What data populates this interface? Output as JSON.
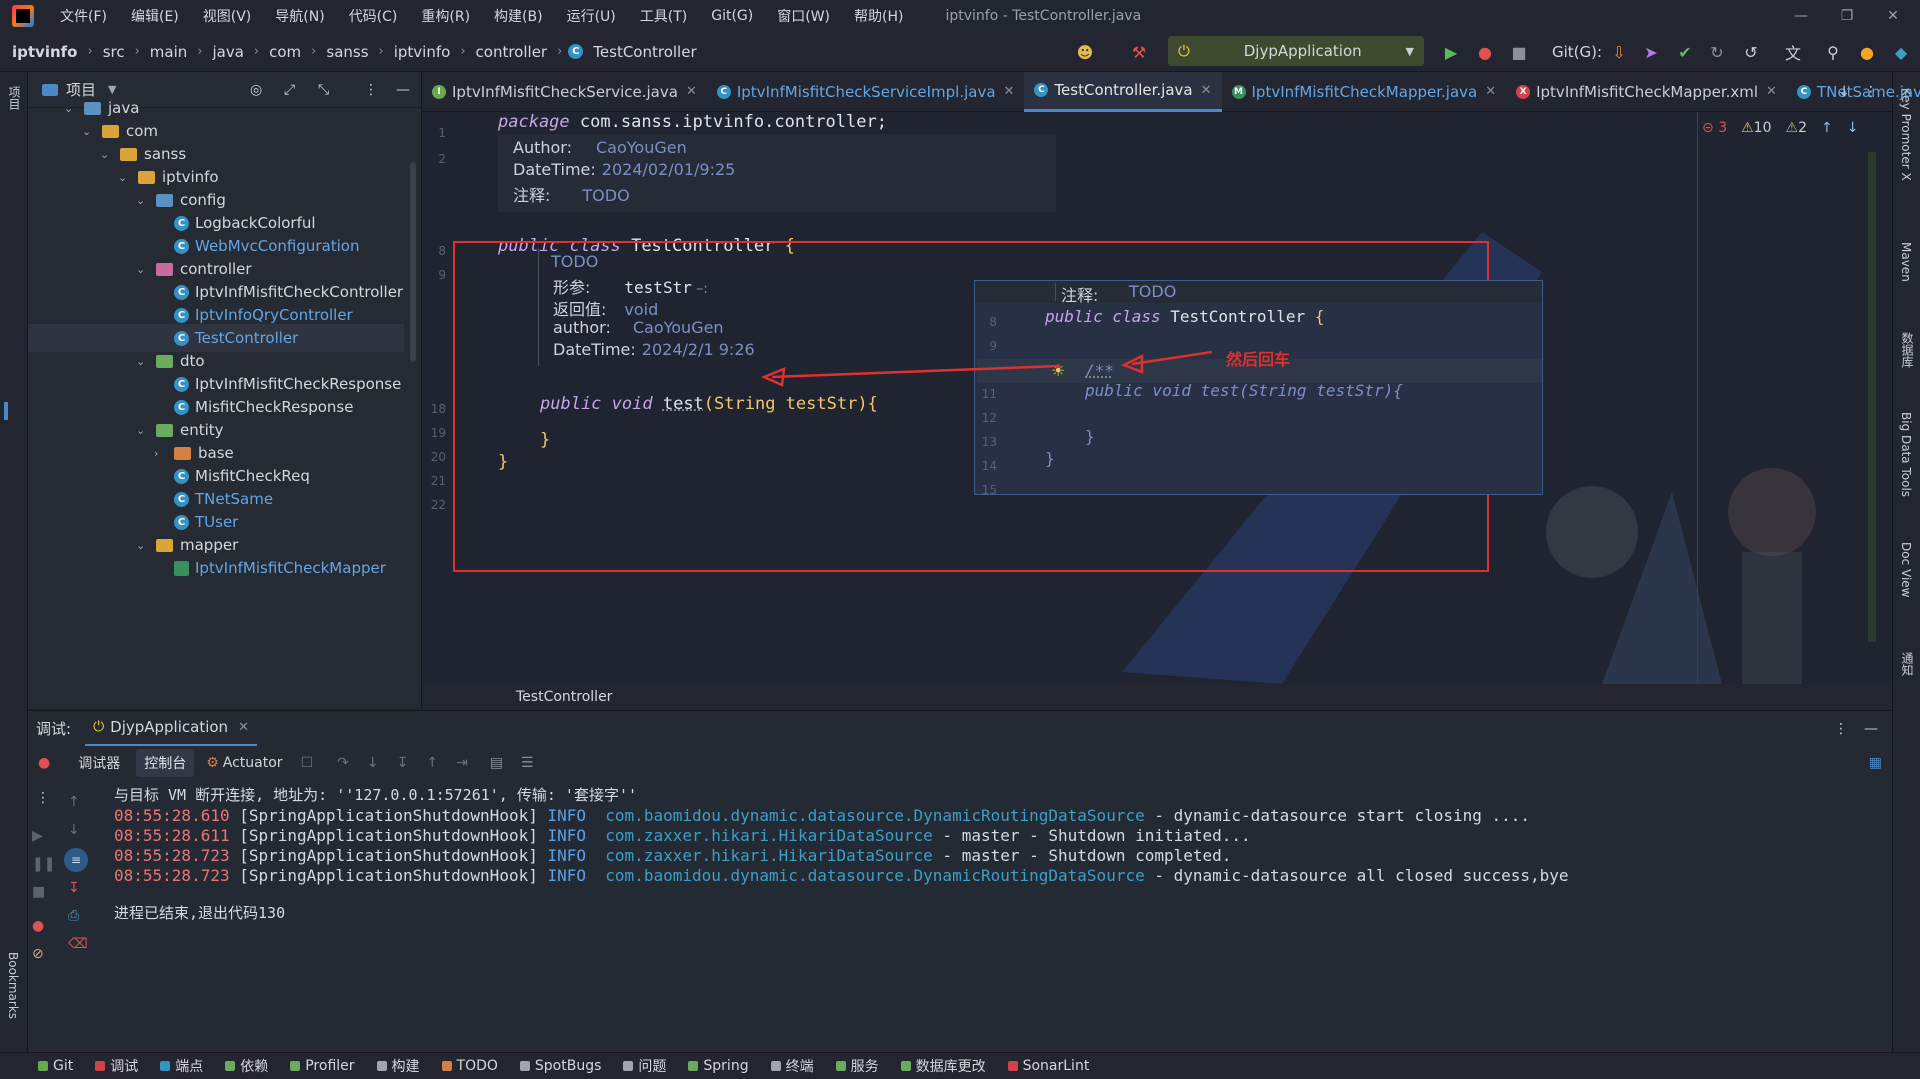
{
  "menu": [
    "文件(F)",
    "编辑(E)",
    "视图(V)",
    "导航(N)",
    "代码(C)",
    "重构(R)",
    "构建(B)",
    "运行(U)",
    "工具(T)",
    "Git(G)",
    "窗口(W)",
    "帮助(H)"
  ],
  "window_title": "iptvinfo - TestController.java",
  "breadcrumbs": [
    "iptvinfo",
    "src",
    "main",
    "java",
    "com",
    "sanss",
    "iptvinfo",
    "controller",
    "TestController"
  ],
  "run_config": "DjypApplication",
  "git_label": "Git(G):",
  "project_panel": {
    "title": "项目",
    "tree": [
      {
        "label": "java",
        "level": 0,
        "kind": "folder-pkg",
        "expanded": true
      },
      {
        "label": "com",
        "level": 1,
        "kind": "folder",
        "expanded": true
      },
      {
        "label": "sanss",
        "level": 2,
        "kind": "folder",
        "expanded": true
      },
      {
        "label": "iptvinfo",
        "level": 3,
        "kind": "folder",
        "expanded": true
      },
      {
        "label": "config",
        "level": 4,
        "kind": "folder-pkg",
        "expanded": true
      },
      {
        "label": "LogbackColorful",
        "level": 5,
        "kind": "class"
      },
      {
        "label": "WebMvcConfiguration",
        "level": 5,
        "kind": "class-blue"
      },
      {
        "label": "controller",
        "level": 4,
        "kind": "folder-pink",
        "expanded": true
      },
      {
        "label": "IptvInfMisfitCheckController",
        "level": 5,
        "kind": "class"
      },
      {
        "label": "IptvInfoQryController",
        "level": 5,
        "kind": "class-blue"
      },
      {
        "label": "TestController",
        "level": 5,
        "kind": "class-blue",
        "selected": true
      },
      {
        "label": "dto",
        "level": 4,
        "kind": "folder-green",
        "expanded": true
      },
      {
        "label": "IptvInfMisfitCheckResponse",
        "level": 5,
        "kind": "class"
      },
      {
        "label": "MisfitCheckResponse",
        "level": 5,
        "kind": "class"
      },
      {
        "label": "entity",
        "level": 4,
        "kind": "folder-green",
        "expanded": true
      },
      {
        "label": "base",
        "level": 5,
        "kind": "folder-orange",
        "expanded": false
      },
      {
        "label": "MisfitCheckReq",
        "level": 5,
        "kind": "class"
      },
      {
        "label": "TNetSame",
        "level": 5,
        "kind": "class-blue"
      },
      {
        "label": "TUser",
        "level": 5,
        "kind": "class-blue"
      },
      {
        "label": "mapper",
        "level": 4,
        "kind": "folder",
        "expanded": true
      },
      {
        "label": "IptvInfMisfitCheckMapper",
        "level": 5,
        "kind": "mapper"
      }
    ]
  },
  "editor_tabs": [
    {
      "label": "IptvInfMisfitCheckService.java",
      "icon": "I",
      "color": "#6aa84f"
    },
    {
      "label": "IptvInfMisfitCheckServiceImpl.java",
      "icon": "C",
      "color": "#3592c4",
      "blue": true
    },
    {
      "label": "TestController.java",
      "icon": "C",
      "color": "#3592c4",
      "active": true
    },
    {
      "label": "IptvInfMisfitCheckMapper.java",
      "icon": "M",
      "color": "#3a8f5e",
      "blue": true
    },
    {
      "label": "IptvInfMisfitCheckMapper.xml",
      "icon": "X",
      "color": "#d0434a"
    },
    {
      "label": "TNetSame.java",
      "icon": "C",
      "color": "#3592c4",
      "blue": true
    }
  ],
  "inspections": {
    "errors": "3",
    "warnings": "10",
    "weak": "2"
  },
  "code": {
    "line1": "package com.sanss.iptvinfo.controller;",
    "header_doc": {
      "author_label": "Author:",
      "author": "CaoYouGen",
      "datetime_label": "DateTime:",
      "datetime": "2024/02/01/9:25",
      "note_label": "注释:",
      "note": "TODO"
    },
    "class_kw": "public class",
    "class_name": "TestController",
    "method_doc": {
      "todo": "TODO",
      "param_label": "形参:",
      "param": "testStr",
      "return_label": "返回值:",
      "return": "void",
      "author_label": "author:",
      "author": "CaoYouGen",
      "datetime_label": "DateTime:",
      "datetime": "2024/2/1 9:26"
    },
    "method_kw": "public void",
    "method_name": "test",
    "method_params": "(String testStr){",
    "line_numbers": [
      "1",
      "2",
      "8",
      "9",
      "18",
      "19",
      "20",
      "21",
      "22"
    ]
  },
  "popup": {
    "note_label": "注释:",
    "note": "TODO",
    "class_kw": "public class",
    "class_name": "TestController",
    "doc_start": "/**",
    "method_line": "public void test(String testStr){",
    "close_brace": "}",
    "line_numbers": [
      "8",
      "9",
      "10",
      "11",
      "12",
      "13",
      "14",
      "15"
    ]
  },
  "annotation_text": "然后回车",
  "bottom_breadcrumb": "TestController",
  "run_panel": {
    "label": "调试:",
    "app_tab": "DjypApplication",
    "subtabs": [
      "调试器",
      "控制台",
      "Actuator"
    ]
  },
  "console": {
    "line0": "与目标 VM 断开连接, 地址为: ''127.0.0.1:57261', 传输: '套接字''",
    "logs": [
      {
        "ts": "08:55:28.610",
        "thread": "[SpringApplicationShutdownHook]",
        "level": "INFO",
        "logger": "com.baomidou.dynamic.datasource.DynamicRoutingDataSource",
        "msg": " - dynamic-datasource start closing ...."
      },
      {
        "ts": "08:55:28.611",
        "thread": "[SpringApplicationShutdownHook]",
        "level": "INFO",
        "logger": "com.zaxxer.hikari.HikariDataSource",
        "msg": " - master - Shutdown initiated..."
      },
      {
        "ts": "08:55:28.723",
        "thread": "[SpringApplicationShutdownHook]",
        "level": "INFO",
        "logger": "com.zaxxer.hikari.HikariDataSource",
        "msg": " - master - Shutdown completed."
      },
      {
        "ts": "08:55:28.723",
        "thread": "[SpringApplicationShutdownHook]",
        "level": "INFO",
        "logger": "com.baomidou.dynamic.datasource.DynamicRoutingDataSource",
        "msg": " - dynamic-datasource all closed success,bye"
      }
    ],
    "exit_line": "进程已结束,退出代码130"
  },
  "left_stripe": {
    "project": "项目",
    "bookmarks": "Bookmarks",
    "structure": "结构"
  },
  "right_stripe": [
    "Key Promoter X",
    "Maven",
    "数据库",
    "Big Data Tools",
    "Doc View",
    "通知"
  ],
  "statusbar": [
    {
      "label": "Git",
      "color": "#6aa84f"
    },
    {
      "label": "调试",
      "color": "#d0434a"
    },
    {
      "label": "端点",
      "color": "#3592c4"
    },
    {
      "label": "依赖",
      "color": "#6bab5d"
    },
    {
      "label": "Profiler",
      "color": "#6bab5d"
    },
    {
      "label": "构建",
      "color": "#a0a6b0"
    },
    {
      "label": "TODO",
      "color": "#d47f43"
    },
    {
      "label": "SpotBugs",
      "color": "#a0a6b0"
    },
    {
      "label": "问题",
      "color": "#a0a6b0"
    },
    {
      "label": "Spring",
      "color": "#6bab5d"
    },
    {
      "label": "终端",
      "color": "#a0a6b0"
    },
    {
      "label": "服务",
      "color": "#6bab5d"
    },
    {
      "label": "数据库更改",
      "color": "#6bab5d"
    },
    {
      "label": "SonarLint",
      "color": "#d0434a"
    }
  ]
}
